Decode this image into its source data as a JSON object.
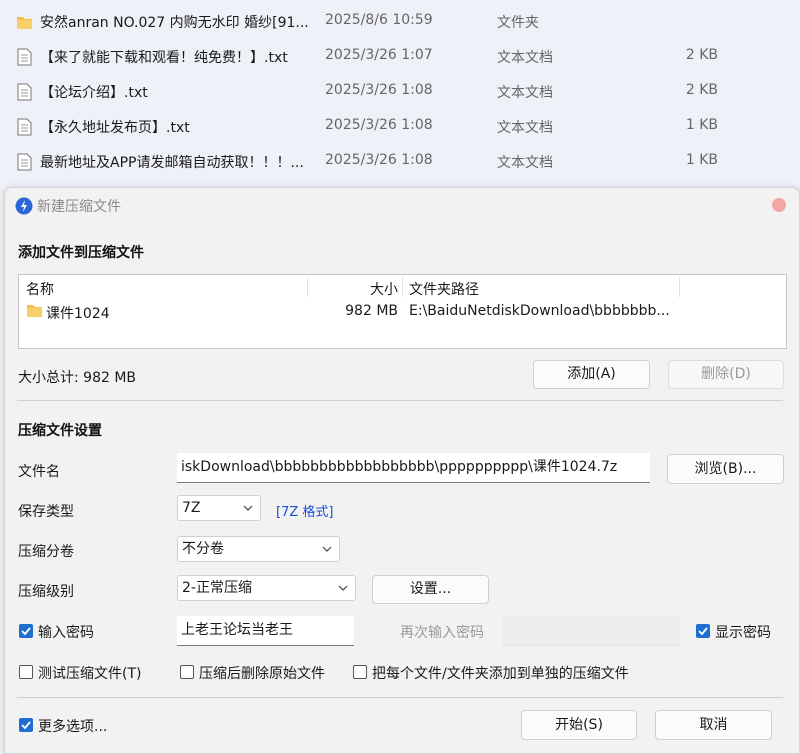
{
  "files": [
    {
      "name": "安然anran NO.027 内购无水印 婚纱[91...",
      "date": "2025/8/6 10:59",
      "type": "文件夹",
      "size": "",
      "icon": "folder-icon"
    },
    {
      "name": "【来了就能下载和观看！纯免费！】.txt",
      "date": "2025/3/26 1:07",
      "type": "文本文档",
      "size": "2 KB",
      "icon": "text-file-icon"
    },
    {
      "name": "【论坛介绍】.txt",
      "date": "2025/3/26 1:08",
      "type": "文本文档",
      "size": "2 KB",
      "icon": "text-file-icon"
    },
    {
      "name": "【永久地址发布页】.txt",
      "date": "2025/3/26 1:08",
      "type": "文本文档",
      "size": "1 KB",
      "icon": "text-file-icon"
    },
    {
      "name": "最新地址及APP请发邮箱自动获取！！！...",
      "date": "2025/3/26 1:08",
      "type": "文本文档",
      "size": "1 KB",
      "icon": "text-file-icon"
    }
  ],
  "dialog": {
    "title": "新建压缩文件",
    "add_section_title": "添加文件到压缩文件",
    "columns": {
      "name": "名称",
      "size": "大小",
      "path": "文件夹路径"
    },
    "entries": [
      {
        "name": "课件1024",
        "size": "982 MB",
        "path": "E:\\BaiduNetdiskDownload\\bbbbbbb...",
        "icon": "folder-icon"
      }
    ],
    "total_size": "大小总计: 982 MB",
    "add_button": "添加(A)",
    "delete_button": "删除(D)",
    "settings_section_title": "压缩文件设置",
    "filename_label": "文件名",
    "filename_value": "iskDownload\\bbbbbbbbbbbbbbbbbb\\pppppppppp\\课件1024.7z",
    "browse_button": "浏览(B)...",
    "save_type_label": "保存类型",
    "save_type_value": "7Z",
    "format_link": "[7Z 格式]",
    "split_label": "压缩分卷",
    "split_value": "不分卷",
    "level_label": "压缩级别",
    "level_value": "2-正常压缩",
    "settings_button": "设置...",
    "password_checkbox": "输入密码",
    "password_checked": true,
    "password_value": "上老王论坛当老王",
    "reenter_password_label": "再次输入密码",
    "show_password_checkbox": "显示密码",
    "show_password_checked": true,
    "test_checkbox": "测试压缩文件(T)",
    "delete_after_checkbox": "压缩后删除原始文件",
    "separate_checkbox": "把每个文件/文件夹添加到单独的压缩文件",
    "more_options_checkbox": "更多选项...",
    "more_options_checked": true,
    "start_button": "开始(S)",
    "cancel_button": "取消"
  },
  "colors": {
    "accent": "#1f6fd1",
    "link": "#1a4fd6",
    "folder": "#f3c04a",
    "close": "#f3a6a6"
  }
}
